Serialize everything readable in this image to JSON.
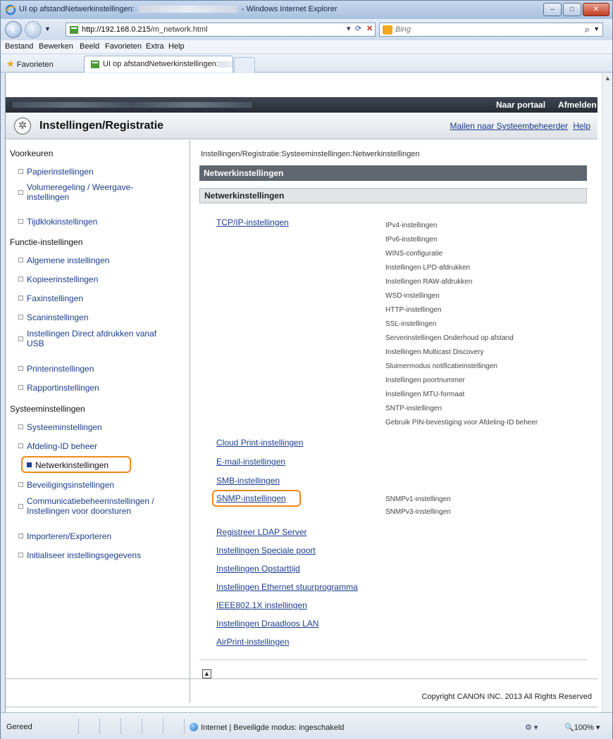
{
  "window": {
    "title_prefix": "UI op afstandNetwerkinstellingen:",
    "title_suffix": "- Windows Internet Explorer",
    "min": "–",
    "max": "□",
    "close": "✕"
  },
  "address": {
    "url_host": "http://192.168.0.215",
    "url_path": "/m_network.html",
    "search_placeholder": "Bing"
  },
  "menu": [
    "Bestand",
    "Bewerken",
    "Beeld",
    "Favorieten",
    "Extra",
    "Help"
  ],
  "favbar": {
    "favorites": "Favorieten",
    "tab_title": "UI op afstandNetwerkinstellingen:"
  },
  "portal": {
    "naar_portaal": "Naar portaal",
    "afmelden": "Afmelden"
  },
  "header": {
    "title": "Instellingen/Registratie",
    "mail_link": "Mailen naar Systeembeheerder",
    "help_link": "Help"
  },
  "sidebar": {
    "sec1": "Voorkeuren",
    "papier": "Papierinstellingen",
    "volume_1": "Volumeregeling / Weergave-",
    "volume_2": "instellingen",
    "tijdklok": "Tijdklokinstellingen",
    "sec2": "Functie-instellingen",
    "algemene": "Algemene instellingen",
    "kopieer": "Kopieerinstellingen",
    "fax": "Faxinstellingen",
    "scan": "Scaninstellingen",
    "direct_1": "Instellingen Direct afdrukken vanaf",
    "direct_2": "USB",
    "printer": "Printerinstellingen",
    "rapport": "Rapportinstellingen",
    "sec3": "Systeeminstellingen",
    "systeem": "Systeeminstellingen",
    "afdeling": "Afdeling-ID beheer",
    "netwerk": "Netwerkinstellingen",
    "beveiliging": "Beveiligingsinstellingen",
    "comm_1": "Communicatiebeheerinstellingen /",
    "comm_2": "Instellingen voor doorsturen",
    "importeren": "Importeren/Exporteren",
    "initialiseer": "Initialiseer instellingsgegevens"
  },
  "main": {
    "breadcrumb": "Instellingen/Registratie:Systeeminstellingen:Netwerkinstellingen",
    "bar_title": "Netwerkinstellingen",
    "section_title": "Netwerkinstellingen",
    "tcpip": "TCP/IP-instellingen",
    "tcpip_sub": [
      "IPv4-instellingen",
      "IPv6-instellingen",
      "WINS-configuratie",
      "Instellingen LPD-afdrukken",
      "Instellingen RAW-afdrukken",
      "WSD-instellingen",
      "HTTP-instellingen",
      "SSL-instellingen",
      "Serverinstellingen Onderhoud op afstand",
      "Instellingen Multicast Discovery",
      "Sluimermodus notificatieinstellingen",
      "Instellingen poortnummer",
      "Instellingen MTU-formaat",
      "SNTP-instellingen",
      "Gebruik PIN-bevestiging voor Afdeling-ID beheer"
    ],
    "cloud": "Cloud Print-instellingen",
    "email": "E-mail-instellingen",
    "smb": "SMB-instellingen",
    "snmp": "SNMP-instellingen",
    "snmp_sub": [
      "SNMPv1-instellingen",
      "SNMPv3-instellingen"
    ],
    "ldap": "Registreer LDAP Server",
    "speciale": "Instellingen Speciale poort",
    "opstart": "Instellingen Opstarttijd",
    "ethernet": "Instellingen Ethernet stuurprogramma",
    "ieee": "IEEE802.1X instellingen",
    "draadloos": "Instellingen Draadloos LAN",
    "airprint": "AirPrint-instellingen",
    "top_button": "▲"
  },
  "footer": {
    "copyright": "Copyright CANON INC. 2013 All Rights Reserved"
  },
  "statusbar": {
    "status": "Gereed",
    "zone": "Internet | Beveiligde modus: ingeschakeld",
    "zoom": "100%"
  },
  "colors": {
    "link": "#1b3d8f",
    "highlight": "#ef8a18",
    "bar_dark": "#5f6670"
  }
}
